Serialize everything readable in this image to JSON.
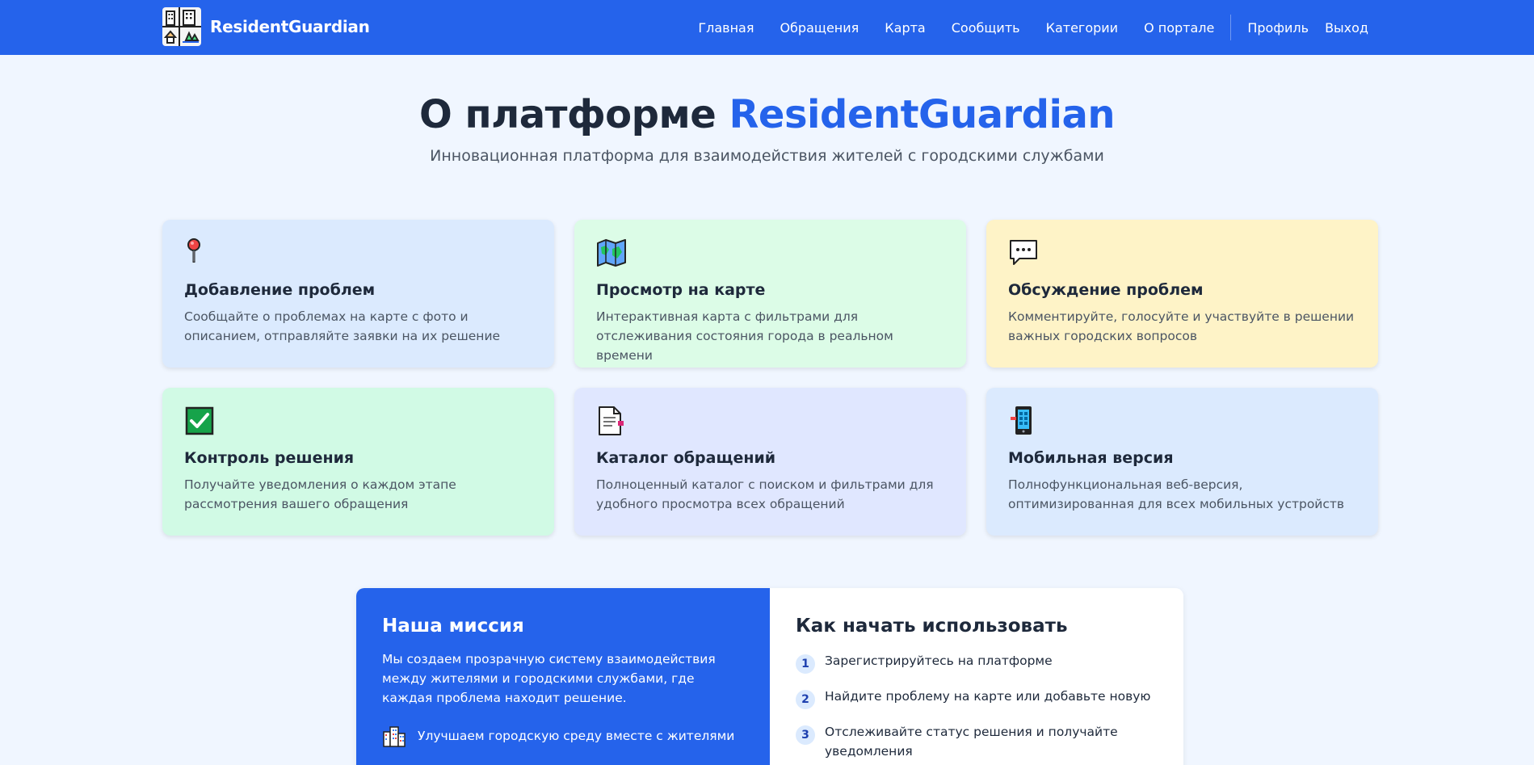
{
  "brand": {
    "name": "ResidentGuardian",
    "logo_icon": "city-buildings-icon"
  },
  "nav": {
    "items": [
      {
        "label": "Главная"
      },
      {
        "label": "Обращения"
      },
      {
        "label": "Карта"
      },
      {
        "label": "Сообщить"
      },
      {
        "label": "Категории"
      },
      {
        "label": "О портале"
      }
    ],
    "user_items": [
      {
        "label": "Профиль"
      },
      {
        "label": "Выход"
      }
    ]
  },
  "hero": {
    "title_prefix": "О платформе",
    "title_accent": "ResidentGuardian",
    "subtitle": "Инновационная платформа для взаимодействия жителей с городскими службами"
  },
  "features": [
    {
      "icon": "map-pin-icon",
      "title": "Добавление проблем",
      "text": "Сообщайте о проблемах на карте с фото и описанием, отправляйте заявки на их решение",
      "bg": "#dbeafe"
    },
    {
      "icon": "map-icon",
      "title": "Просмотр на карте",
      "text": "Интерактивная карта с фильтрами для отслеживания состояния города в реальном времени",
      "bg": "#dcfce7"
    },
    {
      "icon": "speech-bubble-icon",
      "title": "Обсуждение проблем",
      "text": "Комментируйте, голосуйте и участвуйте в решении важных городских вопросов",
      "bg": "#fef3c7"
    },
    {
      "icon": "check-box-icon",
      "title": "Контроль решения",
      "text": "Получайте уведомления о каждом этапе рассмотрения вашего обращения",
      "bg": "#d1fae5"
    },
    {
      "icon": "document-icon",
      "title": "Каталог обращений",
      "text": "Полноценный каталог с поиском и фильтрами для удобного просмотра всех обращений",
      "bg": "#e0e7ff"
    },
    {
      "icon": "mobile-phone-icon",
      "title": "Мобильная версия",
      "text": "Полнофункциональная веб-версия, оптимизированная для всех мобильных устройств",
      "bg": "#dbeafe"
    }
  ],
  "mission": {
    "title": "Наша миссия",
    "text": "Мы создаем прозрачную систему взаимодействия между жителями и городскими службами, где каждая проблема находит решение.",
    "point_icon": "city-icon",
    "point": "Улучшаем городскую среду вместе с жителями"
  },
  "howto": {
    "title": "Как начать использовать",
    "steps": [
      {
        "num": "1",
        "text": "Зарегистрируйтесь на платформе"
      },
      {
        "num": "2",
        "text": "Найдите проблему на карте или добавьте новую"
      },
      {
        "num": "3",
        "text": "Отслеживайте статус решения и получайте уведомления"
      }
    ]
  },
  "colors": {
    "primary": "#2563eb",
    "page_bg": "#f0f6ff",
    "heading": "#1e293b"
  }
}
